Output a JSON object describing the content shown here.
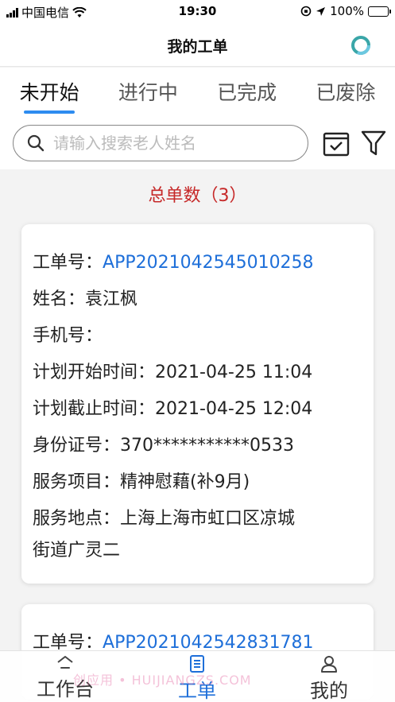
{
  "status_bar": {
    "carrier": "中国电信",
    "time": "19:30",
    "battery": "100%"
  },
  "header": {
    "title": "我的工单"
  },
  "tabs": [
    {
      "label": "未开始",
      "active": true
    },
    {
      "label": "进行中",
      "active": false
    },
    {
      "label": "已完成",
      "active": false
    },
    {
      "label": "已废除",
      "active": false
    }
  ],
  "search": {
    "placeholder": "请输入搜索老人姓名",
    "value": ""
  },
  "total": {
    "text": "总单数（3）"
  },
  "cards": [
    {
      "order_label": "工单号：",
      "order_no": "APP2021042545010258",
      "name_label": "姓名：",
      "name": "袁江枫",
      "phone_label": "手机号：",
      "phone": "",
      "plan_start_label": "计划开始时间：",
      "plan_start": "2021-04-25 11:04",
      "plan_end_label": "计划截止时间：",
      "plan_end": "2021-04-25 12:04",
      "id_label": "身份证号：",
      "id_no": "370***********0533",
      "service_label": "服务项目：",
      "service": "精神慰藉(补9月)",
      "place_label": "服务地点：",
      "place_line1": "上海上海市虹口区凉城",
      "place_line2": "街道广灵二"
    },
    {
      "order_label": "工单号：",
      "order_no": "APP2021042542831781"
    }
  ],
  "bottom_nav": [
    {
      "label": "工作台",
      "icon": "home-icon",
      "active": false
    },
    {
      "label": "工单",
      "icon": "document-icon",
      "active": true
    },
    {
      "label": "我的",
      "icon": "user-icon",
      "active": false
    }
  ],
  "watermark": "创应用 • HUIJIANGZS.COM",
  "colors": {
    "accent": "#2d8cf0",
    "link": "#1e6fd9",
    "total": "#c62828"
  }
}
